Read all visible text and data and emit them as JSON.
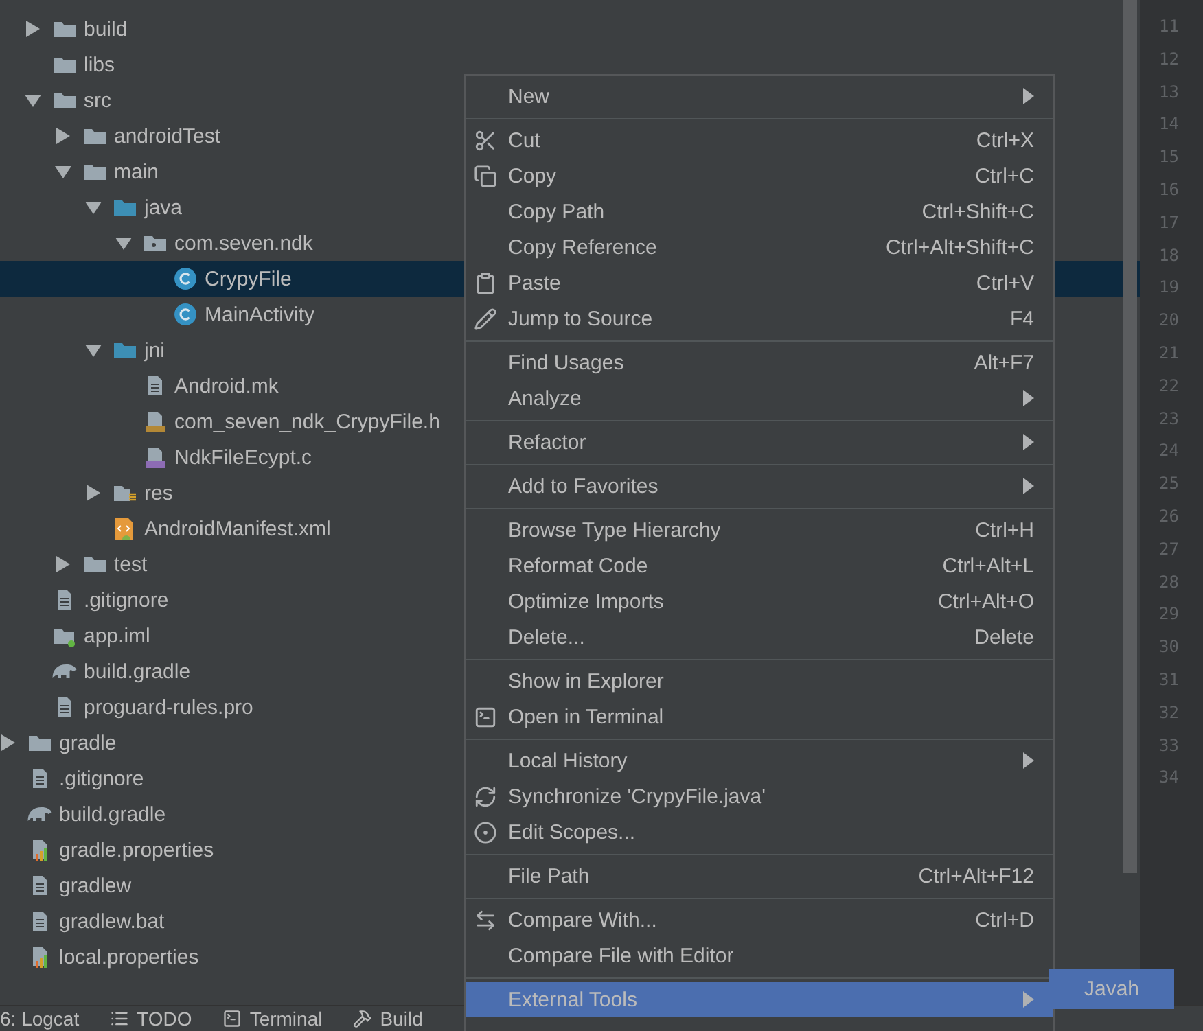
{
  "project_tree": {
    "module_children": [
      {
        "kind": "folder",
        "label": "build",
        "expanded": false,
        "selected": false
      },
      {
        "kind": "folder",
        "label": "libs",
        "selected": false
      },
      {
        "kind": "folder",
        "label": "src",
        "expanded": true,
        "selected": false,
        "children": [
          {
            "kind": "folder",
            "label": "androidTest",
            "expanded": false,
            "selected": false
          },
          {
            "kind": "folder",
            "label": "main",
            "expanded": true,
            "selected": false,
            "children": [
              {
                "kind": "source-folder",
                "label": "java",
                "expanded": true,
                "selected": false,
                "children": [
                  {
                    "kind": "package",
                    "label": "com.seven.ndk",
                    "expanded": true,
                    "selected": false,
                    "children": [
                      {
                        "kind": "class",
                        "label": "CrypyFile",
                        "selected": true
                      },
                      {
                        "kind": "class",
                        "label": "MainActivity",
                        "selected": false
                      }
                    ]
                  }
                ]
              },
              {
                "kind": "source-folder",
                "label": "jni",
                "expanded": true,
                "selected": false,
                "children": [
                  {
                    "kind": "file",
                    "label": "Android.mk",
                    "selected": false
                  },
                  {
                    "kind": "header",
                    "label": "com_seven_ndk_CrypyFile.h",
                    "selected": false
                  },
                  {
                    "kind": "c-file",
                    "label": "NdkFileEcypt.c",
                    "selected": false
                  }
                ]
              },
              {
                "kind": "res-folder",
                "label": "res",
                "expanded": false,
                "selected": false
              },
              {
                "kind": "manifest",
                "label": "AndroidManifest.xml",
                "selected": false
              }
            ]
          },
          {
            "kind": "folder",
            "label": "test",
            "expanded": false,
            "selected": false
          }
        ]
      },
      {
        "kind": "file",
        "label": ".gitignore",
        "selected": false
      },
      {
        "kind": "module-file",
        "label": "app.iml",
        "selected": false
      },
      {
        "kind": "gradle",
        "label": "build.gradle",
        "selected": false
      },
      {
        "kind": "file",
        "label": "proguard-rules.pro",
        "selected": false
      }
    ],
    "root_items": [
      {
        "kind": "folder",
        "label": "gradle",
        "expanded": false,
        "selected": false
      },
      {
        "kind": "file",
        "label": ".gitignore",
        "selected": false
      },
      {
        "kind": "gradle",
        "label": "build.gradle",
        "selected": false
      },
      {
        "kind": "properties",
        "label": "gradle.properties",
        "selected": false
      },
      {
        "kind": "file",
        "label": "gradlew",
        "selected": false
      },
      {
        "kind": "file",
        "label": "gradlew.bat",
        "selected": false
      },
      {
        "kind": "properties",
        "label": "local.properties",
        "selected": false
      }
    ]
  },
  "context_menu": {
    "groups": [
      [
        {
          "label": "New",
          "submenu": true,
          "selected": false
        }
      ],
      [
        {
          "kind": "cut",
          "label": "Cut",
          "shortcut": "Ctrl+X",
          "submenu": false,
          "selected": false
        },
        {
          "kind": "copy",
          "label": "Copy",
          "shortcut": "Ctrl+C",
          "submenu": false,
          "selected": false
        },
        {
          "label": "Copy Path",
          "shortcut": "Ctrl+Shift+C",
          "submenu": false,
          "selected": false
        },
        {
          "label": "Copy Reference",
          "shortcut": "Ctrl+Alt+Shift+C",
          "submenu": false,
          "selected": false
        },
        {
          "kind": "paste",
          "label": "Paste",
          "shortcut": "Ctrl+V",
          "submenu": false,
          "selected": false
        },
        {
          "kind": "jump",
          "label": "Jump to Source",
          "shortcut": "F4",
          "submenu": false,
          "selected": false
        }
      ],
      [
        {
          "label": "Find Usages",
          "shortcut": "Alt+F7",
          "submenu": false,
          "selected": false
        },
        {
          "label": "Analyze",
          "submenu": true,
          "selected": false
        }
      ],
      [
        {
          "label": "Refactor",
          "submenu": true,
          "selected": false
        }
      ],
      [
        {
          "label": "Add to Favorites",
          "submenu": true,
          "selected": false
        }
      ],
      [
        {
          "label": "Browse Type Hierarchy",
          "shortcut": "Ctrl+H",
          "submenu": false,
          "selected": false
        },
        {
          "label": "Reformat Code",
          "shortcut": "Ctrl+Alt+L",
          "submenu": false,
          "selected": false
        },
        {
          "label": "Optimize Imports",
          "shortcut": "Ctrl+Alt+O",
          "submenu": false,
          "selected": false
        },
        {
          "label": "Delete...",
          "shortcut": "Delete",
          "submenu": false,
          "selected": false
        }
      ],
      [
        {
          "label": "Show in Explorer",
          "submenu": false,
          "selected": false
        },
        {
          "kind": "terminal",
          "label": "Open in Terminal",
          "submenu": false,
          "selected": false
        }
      ],
      [
        {
          "label": "Local History",
          "submenu": true,
          "selected": false
        },
        {
          "kind": "sync",
          "label": "Synchronize 'CrypyFile.java'",
          "submenu": false,
          "selected": false
        },
        {
          "kind": "scope",
          "label": "Edit Scopes...",
          "submenu": false,
          "selected": false
        }
      ],
      [
        {
          "label": "File Path",
          "shortcut": "Ctrl+Alt+F12",
          "submenu": false,
          "selected": false
        }
      ],
      [
        {
          "kind": "compare",
          "label": "Compare With...",
          "shortcut": "Ctrl+D",
          "submenu": false,
          "selected": false
        },
        {
          "label": "Compare File with Editor",
          "submenu": false,
          "selected": false
        }
      ],
      [
        {
          "label": "External Tools",
          "submenu": true,
          "selected": true
        }
      ]
    ]
  },
  "submenu": {
    "items": [
      {
        "label": "Javah",
        "selected": true
      }
    ]
  },
  "gutter": {
    "line_numbers": [
      "11",
      "12",
      "13",
      "14",
      "15",
      "16",
      "17",
      "18",
      "19",
      "20",
      "21",
      "22",
      "23",
      "24",
      "25",
      "26",
      "27",
      "28",
      "29",
      "30",
      "31",
      "32",
      "33",
      "34"
    ]
  },
  "tool_window_bar": {
    "tabs": [
      {
        "kind": "logcat",
        "label": "6: Logcat"
      },
      {
        "kind": "todo",
        "label": "TODO"
      },
      {
        "kind": "terminal",
        "label": "Terminal"
      },
      {
        "kind": "build",
        "label": "Build"
      }
    ]
  }
}
